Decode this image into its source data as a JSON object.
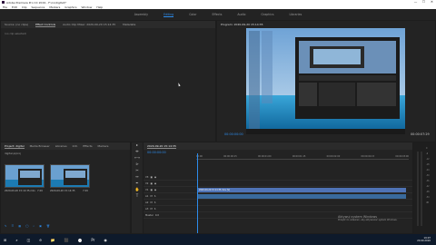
{
  "window": {
    "title": "Adobe Premiere Pro CC 2019 - F:\\cv\\digital\\*",
    "minimize": "—",
    "maximize": "☐",
    "close": "✕"
  },
  "menu": [
    "File",
    "Edit",
    "Clip",
    "Sequence",
    "Markers",
    "Graphics",
    "Window",
    "Help"
  ],
  "workspaces": {
    "items": [
      "Assembly",
      "Editing",
      "Color",
      "Effects",
      "Audio",
      "Graphics",
      "Libraries"
    ],
    "active_index": 1
  },
  "source_panel": {
    "tabs": [
      "Source: (no clips)",
      "Effect Controls",
      "Audio Clip Mixer: 2020-09-20 15:14:35",
      "Metadata"
    ],
    "active_tab_index": 1,
    "message": "(no clip selected)"
  },
  "program_panel": {
    "header": "Program: 2020-09-20 15:14:35",
    "timecode_left": "00:00:00:00",
    "timecode_right": "00:00:07:29",
    "fit": "Fit",
    "quality": "Full"
  },
  "program_controls": [
    "⇤",
    "◂",
    "◁",
    "▶",
    "▷",
    "▸",
    "⇥",
    "⧉",
    "⊡",
    "+"
  ],
  "project_panel": {
    "tabs": [
      "Project: digital",
      "Media Browser",
      "Libraries",
      "Info",
      "Effects",
      "Markers"
    ],
    "active_tab_index": 0,
    "project_name": "digital.prproj",
    "items": [
      {
        "name": "2020-09-20 15:14:35.mkv",
        "duration": "7:29"
      },
      {
        "name": "2020-09-20 15:14:35",
        "duration": "7:29"
      }
    ],
    "bottom_icons": [
      "✎",
      "☰",
      "▦",
      "◯",
      "⌕",
      "▣",
      "🗑"
    ]
  },
  "tools": [
    "▸",
    "⇹",
    "⟷",
    "⊳",
    "✂",
    "↔",
    "✒",
    "✋",
    "T"
  ],
  "timeline": {
    "tab": "2020-09-20 15:14:35",
    "timecode": "00:00:00:00",
    "ruler_labels": [
      "00:00",
      "00:00:00:15",
      "00:00:01:00",
      "00:00:01:15",
      "00:00:02:00",
      "00:00:02:15",
      "00:00:03:00",
      "00:00:03:15",
      "00:00:04:00",
      "00:00:04:15",
      "00:00:05:00",
      "00:00:05:15",
      "00:00:06:00",
      "00:00:06:15"
    ],
    "tracks": [
      "V3",
      "V2",
      "V1",
      "A1",
      "A2",
      "A3",
      "Master"
    ],
    "video_clip": "2020-09-20 15:14:35.mkv [V]",
    "audio_clip": "",
    "master_value": "0.0"
  },
  "meters_scale": [
    "0",
    "-6",
    "-12",
    "-18",
    "-24",
    "-30",
    "-36",
    "-42",
    "-48",
    "-54",
    "dB"
  ],
  "watermark": {
    "line1": "Aktywuj system Windows",
    "line2": "Przejdź do ustawień, aby aktywować system Windows."
  },
  "taskbar": {
    "time": "19:07",
    "date": "20.09.2020",
    "apps": [
      "⊞",
      "⌕",
      "◫",
      "e",
      "📁",
      "⬛",
      "⬤",
      "Pr",
      "◉"
    ]
  },
  "colors": {
    "accent": "#2d8ceb",
    "panel": "#232323",
    "clip_video": "#4f73b5",
    "taskbar": "#0e1a2b"
  }
}
